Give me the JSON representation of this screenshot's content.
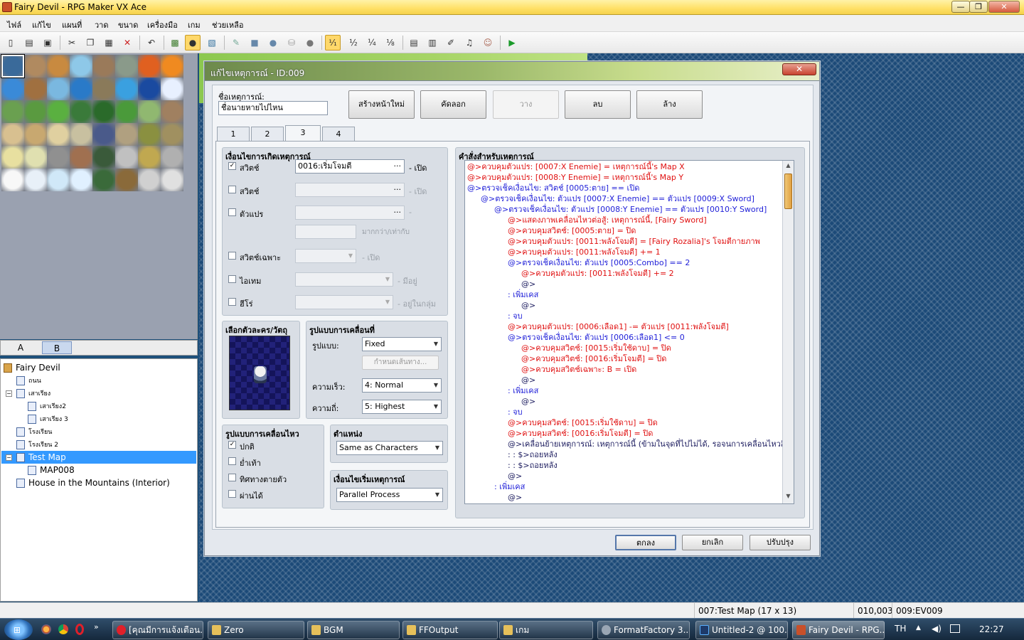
{
  "window": {
    "title": "Fairy Devil - RPG Maker VX Ace",
    "minimize": "—",
    "maximize": "❐",
    "close": "✕"
  },
  "menu": [
    "ไฟล์",
    "แก้ไข",
    "แผนที่",
    "วาด",
    "ขนาด",
    "เครื่องมือ",
    "เกม",
    "ช่วยเหลือ"
  ],
  "toolbar": {
    "icons": [
      "new-project-icon",
      "open-project-icon",
      "save-icon",
      "cut-icon",
      "copy-icon",
      "paste-icon",
      "delete-icon",
      "undo-icon",
      "map-layer-icon",
      "event-layer-icon",
      "region-layer-icon",
      "pencil-icon",
      "rectangle-icon",
      "ellipse-icon",
      "flood-fill-icon",
      "shadow-pen-icon",
      "zoom-1-1-icon",
      "zoom-1-2-icon",
      "zoom-1-4-icon",
      "zoom-1-8-icon",
      "database-icon",
      "resource-manager-icon",
      "script-editor-icon",
      "sound-test-icon",
      "character-generator-icon",
      "playtest-icon"
    ],
    "zoom_labels": [
      "¹⁄₁",
      "½",
      "¼",
      "⅛"
    ]
  },
  "tileset_tabs": [
    "A",
    "B"
  ],
  "map_tree": {
    "project": "Fairy Devil",
    "items": [
      {
        "label": "ถนน"
      },
      {
        "label": "เสาเรียง"
      },
      {
        "label": "เสาเรียง2"
      },
      {
        "label": "เสาเรียง 3"
      },
      {
        "label": "โรงเรียน"
      },
      {
        "label": "โรงเรียน 2"
      },
      {
        "label": "Test Map"
      },
      {
        "label": "MAP008"
      },
      {
        "label": "House in the Mountains (Interior)"
      }
    ],
    "selected": "Test Map"
  },
  "dialog": {
    "title": "แก้ไขเหตุการณ์ - ID:009",
    "close": "✕",
    "name_label": "ชื่อเหตุการณ์:",
    "name_value": "ชื่อนายหายไปไหน",
    "buttons": {
      "new_page": "สร้างหน้าใหม่",
      "copy": "คัดลอก",
      "paste": "วาง",
      "delete": "ลบ",
      "clear": "ล้าง"
    },
    "tabs": [
      "1",
      "2",
      "3",
      "4"
    ],
    "active_tab": "3",
    "conditions": {
      "title": "เงื่อนไขการเกิดเหตุการณ์",
      "switch1": {
        "label": "สวิตช์",
        "checked": true,
        "value": "0016:เริ่มโจมตี",
        "suffix": "- เปิด"
      },
      "switch2": {
        "label": "สวิตช์",
        "checked": false,
        "value": "",
        "suffix": "- เปิด"
      },
      "variable": {
        "label": "ตัวแปร",
        "checked": false,
        "value": "",
        "suffix": "-",
        "compare": "มากกว่า/เท่ากับ"
      },
      "self_switch": {
        "label": "สวิตช์เฉพาะ",
        "checked": false,
        "suffix": "- เปิด"
      },
      "item": {
        "label": "ไอเทม",
        "checked": false,
        "suffix": "- มีอยู่"
      },
      "actor": {
        "label": "ฮีโร่",
        "checked": false,
        "suffix": "- อยู่ในกลุ่ม"
      }
    },
    "graphic": {
      "title": "เลือกตัวละคร/วัตถุ"
    },
    "movement": {
      "title": "รูปแบบการเคลื่อนที่",
      "type_label": "รูปแบบ:",
      "type_value": "Fixed",
      "route_button": "กำหนดเส้นทาง...",
      "speed_label": "ความเร็ว:",
      "speed_value": "4: Normal",
      "freq_label": "ความถี่:",
      "freq_value": "5: Highest"
    },
    "options": {
      "title": "รูปแบบการเคลื่อนไหว",
      "items": [
        {
          "label": "ปกติ",
          "checked": true
        },
        {
          "label": "ย่ำเท้า",
          "checked": false
        },
        {
          "label": "ทิศทางตายตัว",
          "checked": false
        },
        {
          "label": "ผ่านได้",
          "checked": false
        }
      ]
    },
    "priority": {
      "title": "ตำแหน่ง",
      "value": "Same as Characters"
    },
    "trigger": {
      "title": "เงื่อนไขเริ่มเหตุการณ์",
      "value": "Parallel Process"
    },
    "contents_title": "คำสั่งสำหรับเหตุการณ์",
    "commands": [
      {
        "indent": 0,
        "color": "red",
        "text": "@>ควบคุมตัวแปร: [0007:X Enemie] = เหตุการณ์นี้'s Map X"
      },
      {
        "indent": 0,
        "color": "red",
        "text": "@>ควบคุมตัวแปร: [0008:Y Enemie] = เหตุการณ์นี้'s Map Y"
      },
      {
        "indent": 0,
        "color": "blue",
        "text": "@>ตรวจเช็คเงื่อนไข: สวิตช์ [0005:ตาย] == เปิด"
      },
      {
        "indent": 1,
        "color": "blue",
        "text": "@>ตรวจเช็คเงื่อนไข: ตัวแปร [0007:X Enemie] == ตัวแปร [0009:X Sword]"
      },
      {
        "indent": 2,
        "color": "blue",
        "text": "@>ตรวจเช็คเงื่อนไข: ตัวแปร [0008:Y Enemie] == ตัวแปร [0010:Y Sword]"
      },
      {
        "indent": 3,
        "color": "red",
        "text": "@>แสดงภาพเคลื่อนไหวต่อสู้: เหตุการณ์นี้, [Fairy Sword]"
      },
      {
        "indent": 3,
        "color": "red",
        "text": "@>ควบคุมสวิตช์: [0005:ตาย] = ปิด"
      },
      {
        "indent": 3,
        "color": "red",
        "text": "@>ควบคุมตัวแปร: [0011:พลังโจมตี] = [Fairy Rozalia]'s โจมตีกายภาพ"
      },
      {
        "indent": 3,
        "color": "red",
        "text": "@>ควบคุมตัวแปร: [0011:พลังโจมตี] += 1"
      },
      {
        "indent": 3,
        "color": "blue",
        "text": "@>ตรวจเช็คเงื่อนไข: ตัวแปร [0005:Combo] == 2"
      },
      {
        "indent": 4,
        "color": "red",
        "text": "@>ควบคุมตัวแปร: [0011:พลังโจมตี] += 2"
      },
      {
        "indent": 4,
        "color": "dark",
        "text": "@>"
      },
      {
        "indent": 3,
        "color": "blue",
        "text": " :  เพิ่มเคส"
      },
      {
        "indent": 4,
        "color": "dark",
        "text": "@>"
      },
      {
        "indent": 3,
        "color": "blue",
        "text": " :  จบ"
      },
      {
        "indent": 3,
        "color": "red",
        "text": "@>ควบคุมตัวแปร: [0006:เลือด1] -= ตัวแปร [0011:พลังโจมตี]"
      },
      {
        "indent": 3,
        "color": "blue",
        "text": "@>ตรวจเช็คเงื่อนไข: ตัวแปร [0006:เลือด1] <= 0"
      },
      {
        "indent": 4,
        "color": "red",
        "text": "@>ควบคุมสวิตช์: [0015:เริ่มใช้ดาบ] = ปิด"
      },
      {
        "indent": 4,
        "color": "red",
        "text": "@>ควบคุมสวิตช์: [0016:เริ่มโจมตี] = ปิด"
      },
      {
        "indent": 4,
        "color": "red",
        "text": "@>ควบคุมสวิตช์เฉพาะ: B = เปิด"
      },
      {
        "indent": 4,
        "color": "dark",
        "text": "@>"
      },
      {
        "indent": 3,
        "color": "blue",
        "text": " :  เพิ่มเคส"
      },
      {
        "indent": 4,
        "color": "dark",
        "text": "@>"
      },
      {
        "indent": 3,
        "color": "blue",
        "text": " :  จบ"
      },
      {
        "indent": 3,
        "color": "red",
        "text": "@>ควบคุมสวิตช์: [0015:เริ่มใช้ดาบ] = ปิด"
      },
      {
        "indent": 3,
        "color": "red",
        "text": "@>ควบคุมสวิตช์: [0016:เริ่มโจมตี] = ปิด"
      },
      {
        "indent": 3,
        "color": "dark",
        "text": "@>เคลื่อนย้ายเหตุการณ์: เหตุการณ์นี้ (ข้ามในจุดที่ไปไม่ได้, รอจนการเคลื่อนไหวสิ้น"
      },
      {
        "indent": 3,
        "color": "dark",
        "text": " :                               : $>ถอยหลัง"
      },
      {
        "indent": 3,
        "color": "dark",
        "text": " :                               : $>ถอยหลัง"
      },
      {
        "indent": 3,
        "color": "dark",
        "text": "@>"
      },
      {
        "indent": 2,
        "color": "blue",
        "text": " :  เพิ่มเคส"
      },
      {
        "indent": 3,
        "color": "dark",
        "text": "@>"
      }
    ],
    "footer": {
      "ok": "ตกลง",
      "cancel": "ยกเลิก",
      "apply": "ปรับปรุง"
    }
  },
  "status": {
    "map": "007:Test Map (17 x 13)",
    "coords": "010,003",
    "event": "009:EV009"
  },
  "taskbar": {
    "items": [
      "[คุณมีการแจ้งเตือน...",
      "Zero",
      "BGM",
      "FFOutput",
      "เกม",
      "FormatFactory 3....",
      "Untitled-2 @ 100...",
      "Fairy Devil - RPG..."
    ],
    "lang": "TH",
    "time": "22:27"
  }
}
